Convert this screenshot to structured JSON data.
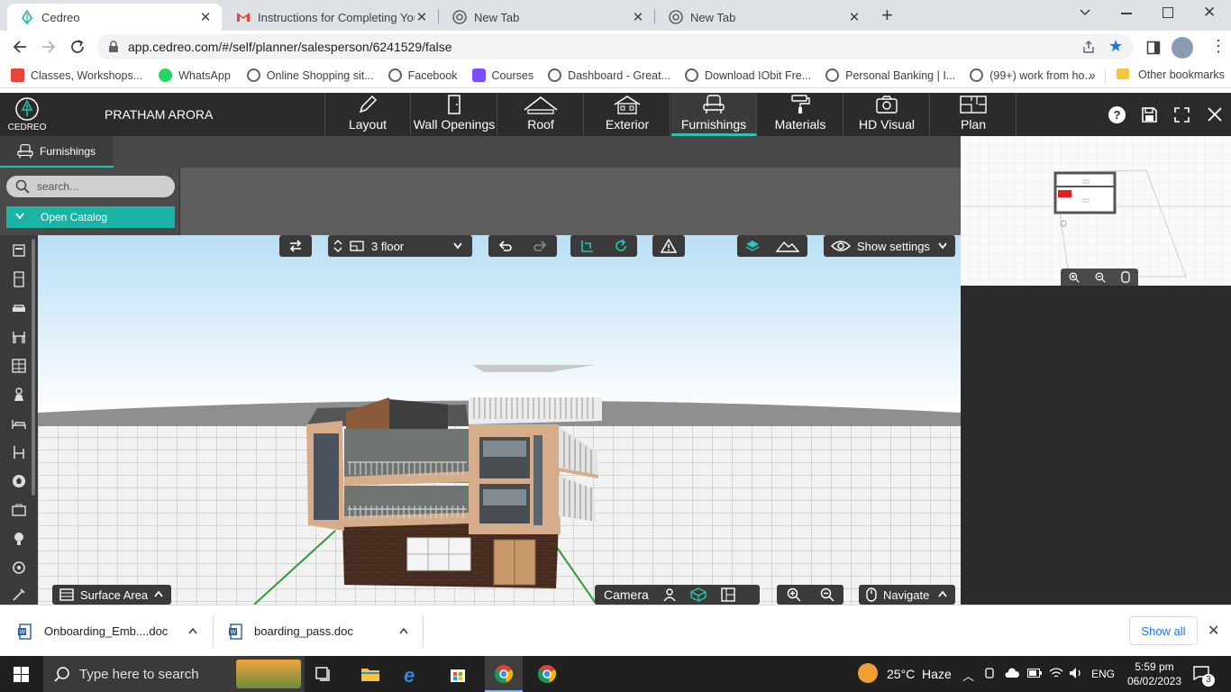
{
  "browser": {
    "tabs": [
      {
        "title": "Cedreo",
        "active": true,
        "icon": "cedreo-favicon"
      },
      {
        "title": "Instructions for Completing Your",
        "active": false,
        "icon": "gmail-favicon"
      },
      {
        "title": "New Tab",
        "active": false,
        "icon": "chrome-favicon"
      },
      {
        "title": "New Tab",
        "active": false,
        "icon": "chrome-favicon"
      }
    ],
    "url": "app.cedreo.com/#/self/planner/salesperson/6241529/false",
    "bookmarks": [
      {
        "label": "Classes, Workshops...",
        "color": "#e8453c"
      },
      {
        "label": "WhatsApp",
        "color": "#25d366"
      },
      {
        "label": "Online Shopping sit...",
        "color": "#5f6368"
      },
      {
        "label": "Facebook",
        "color": "#5f6368"
      },
      {
        "label": "Courses",
        "color": "#7c4dff"
      },
      {
        "label": "Dashboard - Great...",
        "color": "#5f6368"
      },
      {
        "label": "Download IObit Fre...",
        "color": "#5f6368"
      },
      {
        "label": "Personal Banking | I...",
        "color": "#5f6368"
      },
      {
        "label": "(99+) work from ho...",
        "color": "#5f6368"
      }
    ],
    "more_bookmarks": "»",
    "other_bookmarks": "Other bookmarks"
  },
  "app": {
    "logo": "CEDREO",
    "user": "PRATHAM ARORA",
    "nav": [
      {
        "label": "Layout",
        "icon": "pencil-icon"
      },
      {
        "label": "Wall Openings",
        "icon": "door-icon"
      },
      {
        "label": "Roof",
        "icon": "roof-icon"
      },
      {
        "label": "Exterior",
        "icon": "house-icon"
      },
      {
        "label": "Furnishings",
        "icon": "armchair-icon",
        "active": true
      },
      {
        "label": "Materials",
        "icon": "paint-roller-icon"
      },
      {
        "label": "HD Visual",
        "icon": "camera-icon"
      },
      {
        "label": "Plan",
        "icon": "blueprint-icon"
      }
    ],
    "accent": "#27c4b4",
    "panel": {
      "tab": "Furnishings",
      "search_placeholder": "search...",
      "open_catalog": "Open Catalog"
    },
    "toolbar": {
      "floor": "3 floor",
      "show_settings": "Show settings"
    },
    "bottom_tools": {
      "surface_area": "Surface Area",
      "camera": "Camera",
      "navigate": "Navigate"
    }
  },
  "downloads": {
    "items": [
      {
        "name": "Onboarding_Emb....doc"
      },
      {
        "name": "boarding_pass.doc"
      }
    ],
    "show_all": "Show all"
  },
  "taskbar": {
    "search_placeholder": "Type here to search",
    "weather": "25°C  Haze",
    "language": "ENG",
    "time": "5:59 pm",
    "date": "06/02/2023",
    "notifications": "3"
  }
}
